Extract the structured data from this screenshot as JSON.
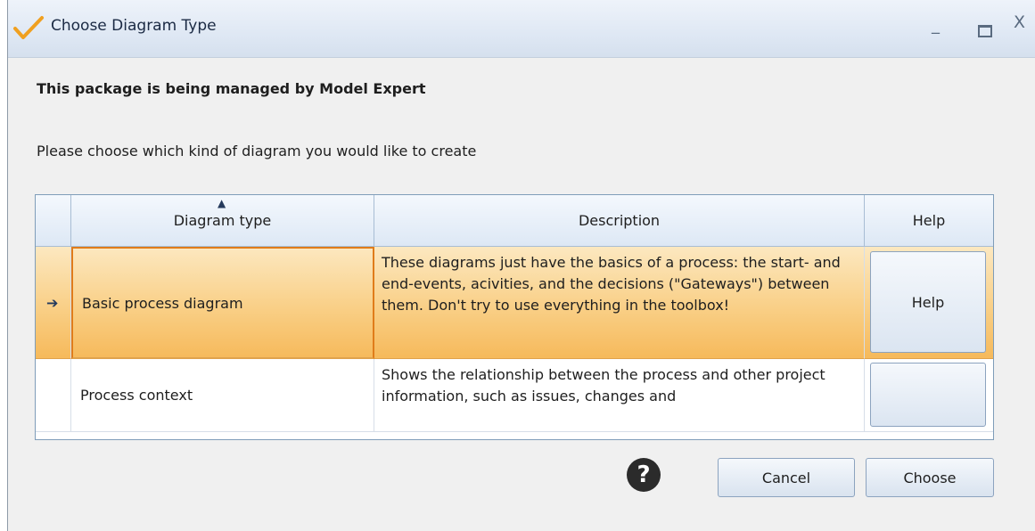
{
  "window": {
    "title": "Choose Diagram Type",
    "close_glyph": "X",
    "minimize_glyph": "_"
  },
  "heading": "This package is being managed by Model Expert",
  "prompt": "Please choose which kind of  diagram you would like to create",
  "grid": {
    "columns": [
      "Diagram type",
      "Description",
      "Help"
    ],
    "rows": [
      {
        "type": "Basic process diagram",
        "description": "These diagrams just have the basics of a process: the start- and end-events, acivities, and the decisions (\"Gateways\") between them. Don't try to use everything in the toolbox!",
        "help": "Help",
        "selected": true
      },
      {
        "type": "Process context",
        "description": "Shows the relationship between the process and other project information, such as issues, changes and",
        "help": "",
        "selected": false
      }
    ]
  },
  "buttons": {
    "help_icon": "?",
    "cancel": "Cancel",
    "choose": "Choose"
  },
  "colors": {
    "selected_row": "#f9cf86",
    "selected_border": "#e07c1a",
    "callout": "#fbe3a6"
  }
}
